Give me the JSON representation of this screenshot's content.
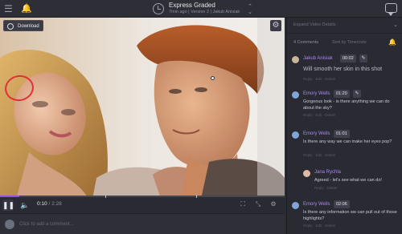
{
  "topbar": {
    "title": "Express Graded",
    "meta": "7min ago  |  Version 2  |  Jakub Anisiak",
    "icons": [
      "menu-icon",
      "bell-icon",
      "history-icon",
      "chevron-updown-icon",
      "chat-icon"
    ]
  },
  "video": {
    "download_label": "Download",
    "gear_icon": "gear-icon"
  },
  "player": {
    "current_time": "0:10",
    "duration": "2:28",
    "progress_fraction": 0.068,
    "marker_fractions": [
      0.37,
      0.69
    ],
    "accent": "#8a52e0",
    "icons": [
      "play-pause-icon",
      "volume-icon",
      "fullscreen-icon",
      "compare-icon",
      "settings-icon"
    ]
  },
  "comment_bar": {
    "placeholder": "Click to add a comment..."
  },
  "sidebar": {
    "header": "Expand Video Details",
    "count": "4 Comments",
    "sort": "Sort by Timecode",
    "comments": [
      {
        "name": "Jakub Anisiak",
        "time": "00:02",
        "text": "Will smooth her skin in this shot",
        "actions": "Reply  ·  Edit  ·  Delete",
        "avatar_color": "#c9b59a",
        "reply": false
      },
      {
        "name": "Emory Wells",
        "time": "01:20",
        "text": "Gorgeous look - is there anything we can do about the sky?",
        "actions": "Reply  ·  Edit  ·  Delete",
        "avatar_color": "#7ea6d8",
        "reply": false
      },
      {
        "name": "Emory Wells",
        "time": "01:01",
        "text": "Is there any way we can make her eyes pop?",
        "actions": "Reply  ·  Edit  ·  Delete",
        "avatar_color": "#7ea6d8",
        "reply": false
      },
      {
        "name": "Jana Rychla",
        "time": "",
        "text": "Agreed - let's see what we can do!",
        "actions": "Reply  ·  Delete",
        "avatar_color": "#e0b9a3",
        "reply": true
      },
      {
        "name": "Emory Wells",
        "time": "02:06",
        "text": "Is there any information we can pull out of those highlights?",
        "actions": "Reply  ·  Edit  ·  Delete",
        "avatar_color": "#7ea6d8",
        "reply": false
      }
    ]
  }
}
